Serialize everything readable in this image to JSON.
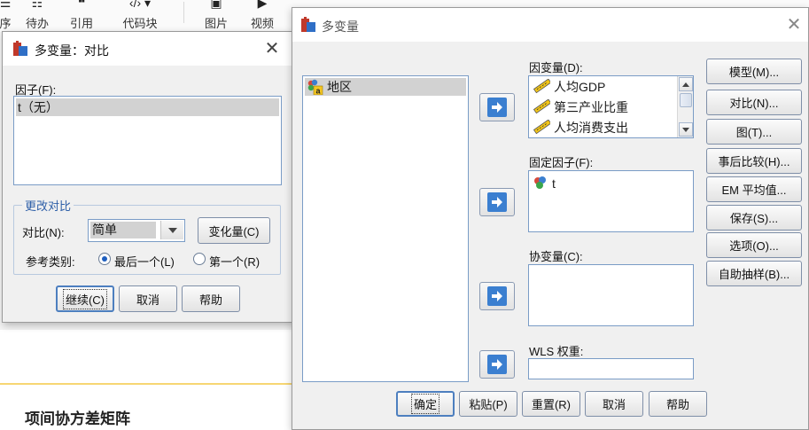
{
  "background": {
    "ribbon_items": [
      {
        "icon": "list-icon",
        "label": "待办"
      },
      {
        "icon": "quote-icon",
        "label": "引用"
      },
      {
        "icon": "code-icon",
        "label": "代码块"
      },
      {
        "icon": "image-icon",
        "label": "图片"
      },
      {
        "icon": "video-icon",
        "label": "视频"
      }
    ],
    "partial_label": "序",
    "doc_heading": "项间协方差矩阵"
  },
  "contrast_dialog": {
    "title": "多变量：对比",
    "factor_label": "因子(F):",
    "factor_items": [
      "t（无）"
    ],
    "group_title": "更改对比",
    "contrast_label": "对比(N):",
    "contrast_value": "简单",
    "change_button": "变化量(C)",
    "reference_label": "参考类别:",
    "radio_last": "最后一个(L)",
    "radio_first": "第一个(R)",
    "reference_selected": "last",
    "continue_button": "继续(C)",
    "cancel_button": "取消",
    "help_button": "帮助"
  },
  "main_dialog": {
    "title": "多变量",
    "source_variables": [
      {
        "name": "地区",
        "icon": "nominal-string-icon"
      }
    ],
    "dependent_label": "因变量(D):",
    "dependent_variables": [
      "人均GDP",
      "第三产业比重",
      "人均消费支出"
    ],
    "fixed_factor_label": "固定因子(F):",
    "fixed_factors": [
      "t"
    ],
    "covariate_label": "协变量(C):",
    "wls_label": "WLS 权重:",
    "side_buttons": [
      "模型(M)...",
      "对比(N)...",
      "图(T)...",
      "事后比较(H)...",
      "EM 平均值...",
      "保存(S)...",
      "选项(O)...",
      "自助抽样(B)..."
    ],
    "bottom_buttons": {
      "ok": "确定",
      "paste": "粘贴(P)",
      "reset": "重置(R)",
      "cancel": "取消",
      "help": "帮助"
    }
  },
  "colors": {
    "accent": "#3b7fd0",
    "group_title": "#2e5fa8",
    "selection": "#d2d2d2"
  }
}
